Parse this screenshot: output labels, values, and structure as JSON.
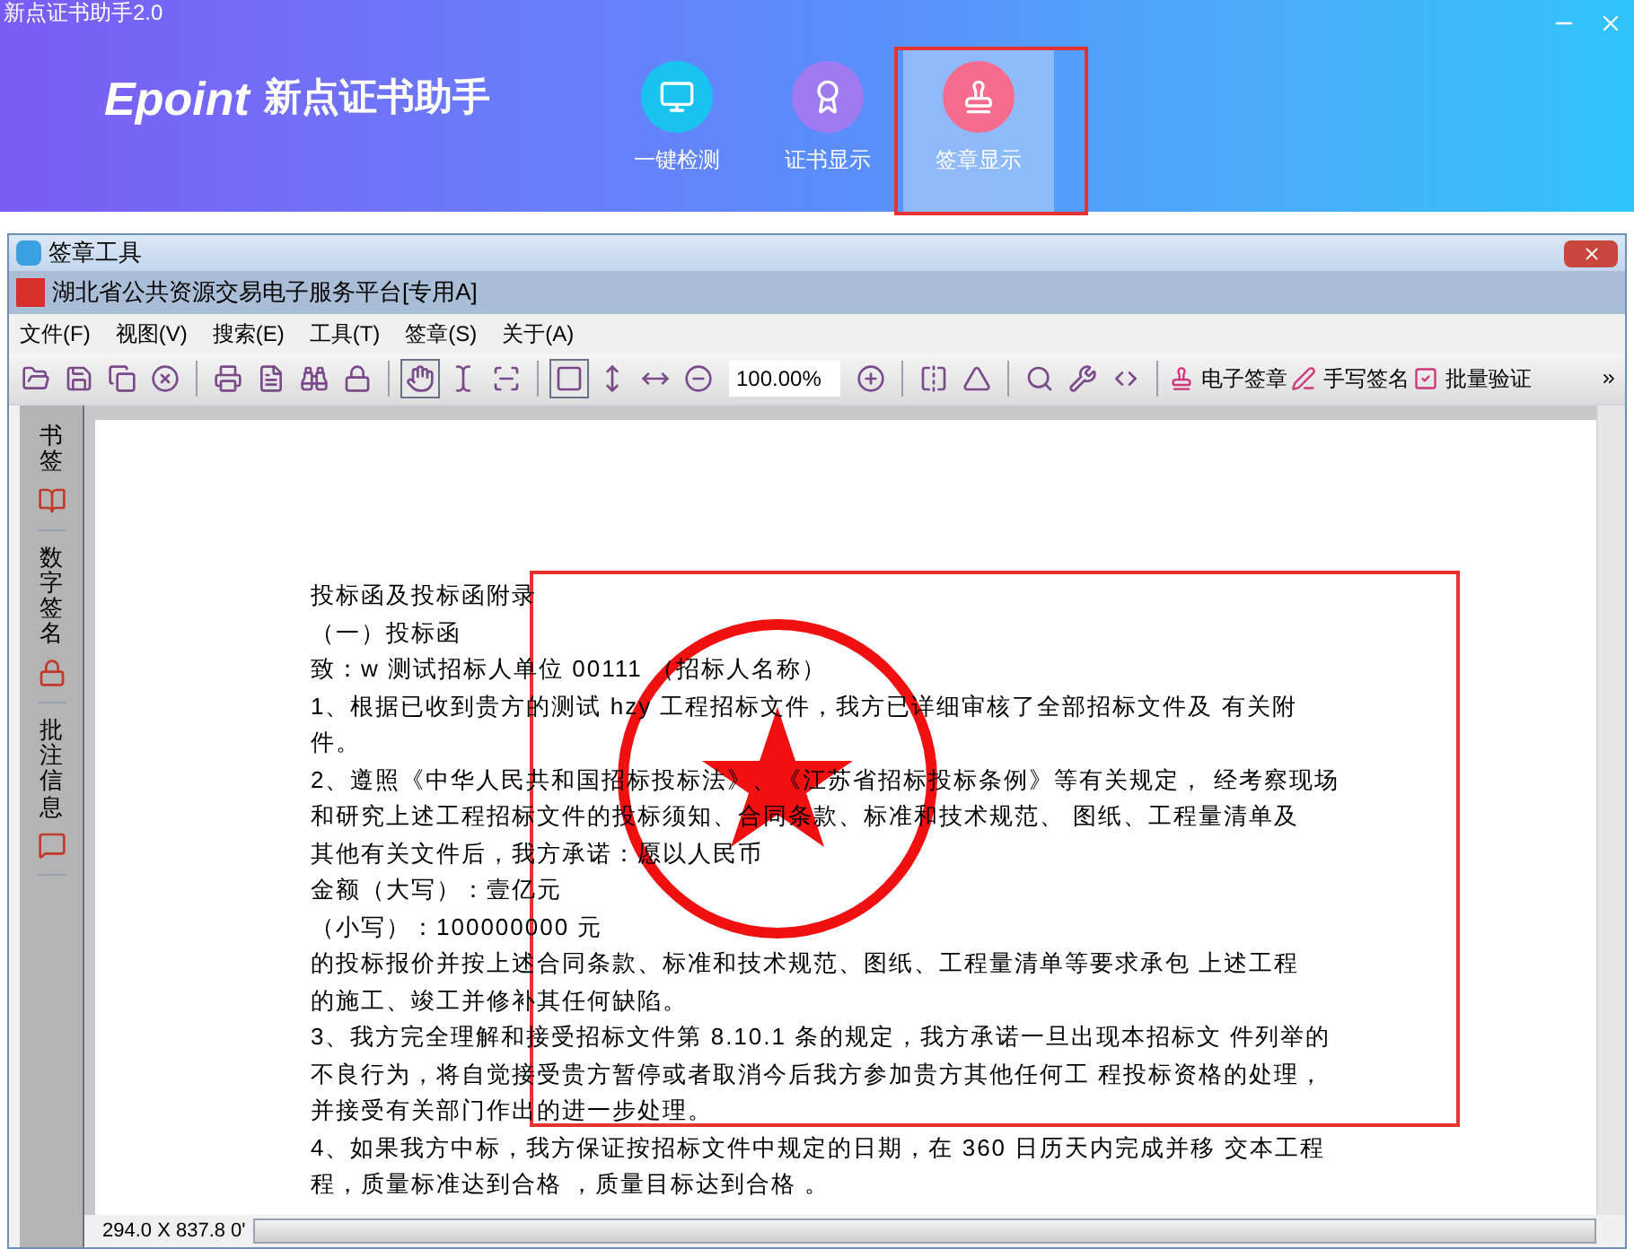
{
  "app": {
    "title": "新点证书助手2.0",
    "logo": "Epoint",
    "name": "新点证书助手"
  },
  "nav": [
    {
      "label": "一键检测",
      "selected": false,
      "kind": "monitor"
    },
    {
      "label": "证书显示",
      "selected": false,
      "kind": "certificate"
    },
    {
      "label": "签章显示",
      "selected": true,
      "kind": "stamp"
    }
  ],
  "window": {
    "title": "签章工具"
  },
  "document_tab": {
    "title": "湖北省公共资源交易电子服务平台[专用A]"
  },
  "menu": [
    "文件(F)",
    "视图(V)",
    "搜索(E)",
    "工具(T)",
    "签章(S)",
    "关于(A)"
  ],
  "toolbar": {
    "zoom": "100.00%",
    "actions": [
      {
        "label": "电子签章",
        "kind": "stamp"
      },
      {
        "label": "手写签名",
        "kind": "pen"
      },
      {
        "label": "批量验证",
        "kind": "check"
      }
    ]
  },
  "side_tabs": [
    {
      "label": "书签",
      "kind": "bookmark"
    },
    {
      "label": "数字签名",
      "kind": "lock"
    },
    {
      "label": "批注信息",
      "kind": "comment"
    }
  ],
  "document": {
    "lines": [
      "投标函及投标函附录",
      "（一）投标函",
      "致：w 测试招标人单位 00111 （招标人名称）",
      "1、根据已收到贵方的测试 hzy 工程招标文件，我方已详细审核了全部招标文件及 有关附",
      "件。",
      "2、遵照《中华人民共和国招标投标法》、《江苏省招标投标条例》等有关规定， 经考察现场",
      "和研究上述工程招标文件的投标须知、合同条款、标准和技术规范、 图纸、工程量清单及",
      "其他有关文件后，我方承诺：愿以人民币",
      "金额（大写）：壹亿元",
      "（小写）：100000000 元",
      "的投标报价并按上述合同条款、标准和技术规范、图纸、工程量清单等要求承包 上述工程",
      "的施工、竣工并修补其任何缺陷。",
      "3、我方完全理解和接受招标文件第 8.10.1 条的规定，我方承诺一旦出现本招标文 件列举的",
      "不良行为，将自觉接受贵方暂停或者取消今后我方参加贵方其他任何工 程投标资格的处理，",
      "并接受有关部门作出的进一步处理。",
      "4、如果我方中标，我方保证按招标文件中规定的日期，在 360 日历天内完成并移 交本工程",
      "程，质量标准达到合格 ，质量目标达到合格 。"
    ]
  },
  "status": {
    "coords": "294.0 X 837.8 0'"
  }
}
